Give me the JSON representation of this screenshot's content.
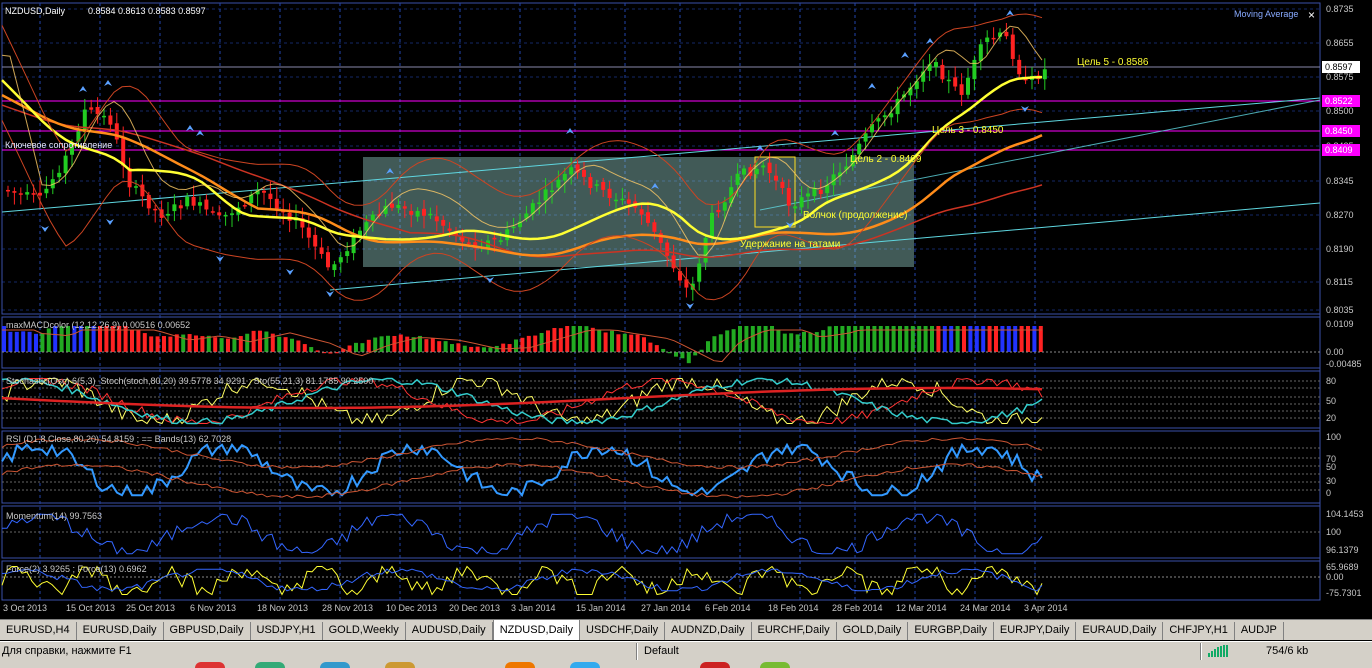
{
  "chart": {
    "title": "NZDUSD,Daily",
    "ohlc": "0.8584 0.8613 0.8583 0.8597",
    "indicator_label": "Moving Average",
    "close_icon": "×",
    "price_scale": [
      "0.8735",
      "0.8655",
      "0.8575",
      "0.8500",
      "0.8425",
      "0.8345",
      "0.8270",
      "0.8190",
      "0.8115",
      "0.8035"
    ],
    "price_tags": [
      {
        "value": "0.8597",
        "color": "#000000",
        "bg": "#ffffff"
      },
      {
        "value": "0.8522",
        "color": "#ffffff",
        "bg": "#ff00ff"
      },
      {
        "value": "0.8450",
        "color": "#ffffff",
        "bg": "#ff00ff"
      },
      {
        "value": "0.8409",
        "color": "#ffffff",
        "bg": "#ff00ff"
      }
    ],
    "annotations": {
      "target5": "Цель 5 - 0.8586",
      "target3": "Цель 3 - 0.8450",
      "target2": "Цель 2  - 0.8409",
      "resistance": "Ключевое сопротивление",
      "wave": "Волчок (продолжение)",
      "hold": "Удержание на татами"
    },
    "dates": [
      "3 Oct 2013",
      "15 Oct 2013",
      "25 Oct 2013",
      "6 Nov 2013",
      "18 Nov 2013",
      "28 Nov 2013",
      "10 Dec 2013",
      "20 Dec 2013",
      "3 Jan 2014",
      "15 Jan 2014",
      "27 Jan 2014",
      "6 Feb 2014",
      "18 Feb 2014",
      "28 Feb 2014",
      "12 Mar 2014",
      "24 Mar 2014",
      "3 Apr 2014"
    ]
  },
  "panels": {
    "macd": {
      "label": "maxMACDcolor (12,12,26,9) 0.00516 0.00652",
      "scale": [
        "0.0109",
        "0.00",
        "-0.00485"
      ]
    },
    "stoch": {
      "label": "Stochastic(Osc) 6(5,3)_Stoch(stoch,80,20) 39.5778 34.9291 ; Sto(55,21,3) 81.1785 90.2500",
      "scale": [
        "80",
        "50",
        "20"
      ]
    },
    "rsi": {
      "label": "RSI (D1,8,Close,80,20) 54.8159 ; == Bands(13) 62.7028",
      "scale": [
        "100",
        "70",
        "50",
        "30",
        "0"
      ]
    },
    "momentum": {
      "label": "Momentum(14) 99.7563",
      "scale": [
        "104.1453",
        "100",
        "96.1379"
      ]
    },
    "force": {
      "label": "Force(2) 3.9265 ; Force(13) 0.6962",
      "scale": [
        "65.9689",
        "0.00",
        "-75.7301"
      ]
    }
  },
  "tabs": [
    "EURUSD,H4",
    "EURUSD,Daily",
    "GBPUSD,Daily",
    "USDJPY,H1",
    "GOLD,Weekly",
    "AUDUSD,Daily",
    "NZDUSD,Daily",
    "USDCHF,Daily",
    "AUDNZD,Daily",
    "EURCHF,Daily",
    "GOLD,Daily",
    "EURGBP,Daily",
    "EURJPY,Daily",
    "EURAUD,Daily",
    "CHFJPY,H1",
    "AUDJP"
  ],
  "active_tab": "NZDUSD,Daily",
  "status": {
    "help": "Для справки, нажмите F1",
    "profile": "Default",
    "traffic": "754/6 kb"
  },
  "colors": {
    "up": "#22cc22",
    "down": "#ff2222",
    "grid": "#2244aa",
    "magenta": "#ff00ff",
    "cyan": "#5fd7e0",
    "ma_yellow": "#ffff33",
    "ma_orange": "#ff8c1a",
    "ma_red": "#cc3322"
  }
}
